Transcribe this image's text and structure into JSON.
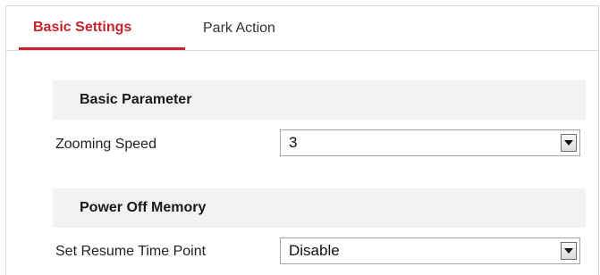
{
  "tabs": {
    "basic_settings": "Basic Settings",
    "park_action": "Park Action",
    "active_color": "#c8232c"
  },
  "basic_parameter": {
    "header": "Basic Parameter",
    "zooming_speed": {
      "label": "Zooming Speed",
      "value": "3"
    }
  },
  "power_off_memory": {
    "header": "Power Off Memory",
    "set_resume_time_point": {
      "label": "Set Resume Time Point",
      "value": "Disable"
    }
  },
  "icons": {
    "dropdown": "chevron-down-icon"
  }
}
